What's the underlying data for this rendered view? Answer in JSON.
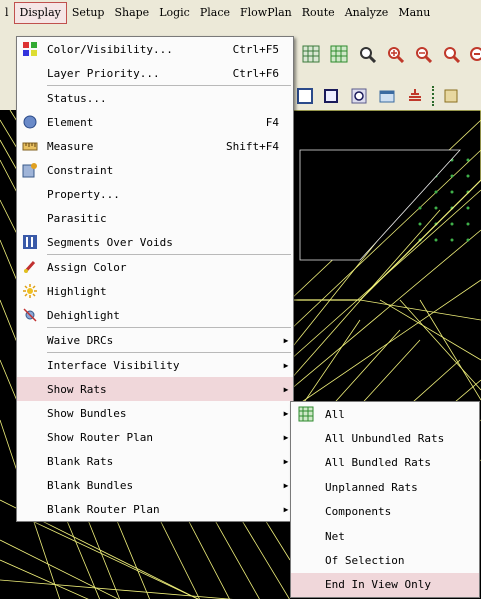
{
  "menubar": {
    "items": [
      "l",
      "Display",
      "Setup",
      "Shape",
      "Logic",
      "Place",
      "FlowPlan",
      "Route",
      "Analyze",
      "Manu"
    ]
  },
  "display_menu": {
    "items": [
      {
        "label": "Color/Visibility...",
        "shortcut": "Ctrl+F5",
        "icon": "color-visibility-icon"
      },
      {
        "label": "Layer Priority...",
        "shortcut": "Ctrl+F6"
      },
      {
        "sep": true
      },
      {
        "label": "Status..."
      },
      {
        "label": "Element",
        "shortcut": "F4",
        "icon": "element-icon"
      },
      {
        "label": "Measure",
        "shortcut": "Shift+F4",
        "icon": "measure-icon"
      },
      {
        "label": "Constraint",
        "icon": "constraint-icon"
      },
      {
        "label": "Property..."
      },
      {
        "label": "Parasitic"
      },
      {
        "label": "Segments Over Voids",
        "icon": "segments-over-voids-icon"
      },
      {
        "sep": true
      },
      {
        "label": "Assign Color",
        "icon": "assign-color-icon"
      },
      {
        "label": "Highlight",
        "icon": "highlight-icon"
      },
      {
        "label": "Dehighlight",
        "icon": "dehighlight-icon"
      },
      {
        "sep": true
      },
      {
        "label": "Waive DRCs",
        "submenu": true
      },
      {
        "sep": true
      },
      {
        "label": "Interface Visibility",
        "submenu": true
      },
      {
        "label": "Show Rats",
        "submenu": true,
        "highlighted": true
      },
      {
        "label": "Show Bundles",
        "submenu": true
      },
      {
        "label": "Show Router Plan",
        "submenu": true
      },
      {
        "label": "Blank Rats",
        "submenu": true
      },
      {
        "label": "Blank Bundles",
        "submenu": true
      },
      {
        "label": "Blank Router Plan",
        "submenu": true
      }
    ]
  },
  "show_rats_menu": {
    "items": [
      {
        "label": "All",
        "icon": "all-rats-icon"
      },
      {
        "label": "All Unbundled Rats"
      },
      {
        "label": "All Bundled Rats"
      },
      {
        "label": "Unplanned Rats"
      },
      {
        "label": "Components"
      },
      {
        "label": "Net"
      },
      {
        "label": "Of Selection"
      },
      {
        "label": "End In View Only",
        "highlighted": true
      }
    ]
  },
  "colors": {
    "menu_bg": "#fbfbfb",
    "highlight": "#f0d7da",
    "toolbar_bg": "#ece9d8",
    "canvas_bg": "#000000",
    "trace": "#f0f07a",
    "accent_border": "#c0504d"
  }
}
